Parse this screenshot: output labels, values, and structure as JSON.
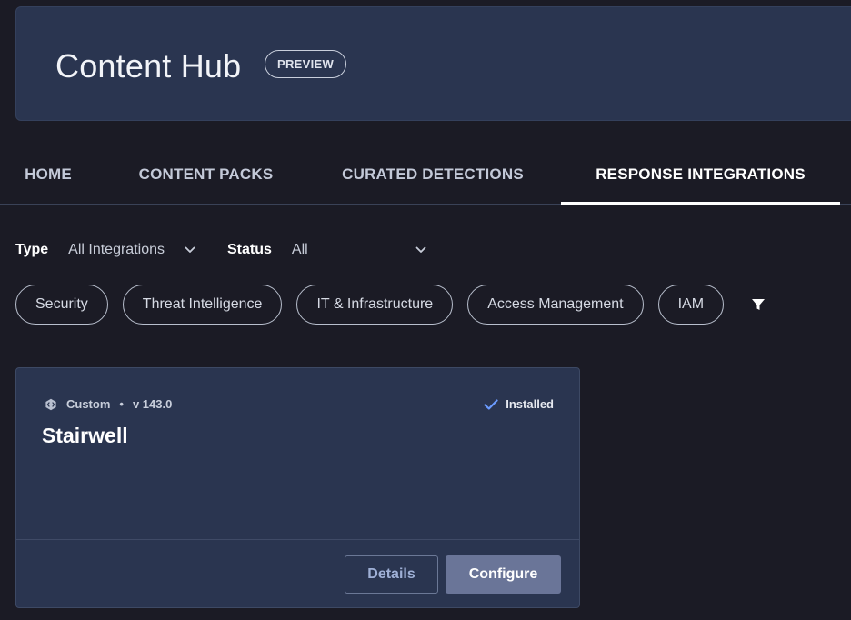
{
  "header": {
    "title": "Content Hub",
    "badge": "PREVIEW"
  },
  "tabs": [
    {
      "label": "HOME",
      "active": false
    },
    {
      "label": "CONTENT PACKS",
      "active": false
    },
    {
      "label": "CURATED DETECTIONS",
      "active": false
    },
    {
      "label": "RESPONSE INTEGRATIONS",
      "active": true
    }
  ],
  "filters": {
    "type_label": "Type",
    "type_value": "All Integrations",
    "status_label": "Status",
    "status_value": "All"
  },
  "chips": [
    "Security",
    "Threat Intelligence",
    "IT & Infrastructure",
    "Access Management",
    "IAM"
  ],
  "card": {
    "source": "Custom",
    "version": "v 143.0",
    "status": "Installed",
    "title": "Stairwell",
    "details_label": "Details",
    "configure_label": "Configure"
  },
  "icons": {
    "chevron": "chevron-down-icon",
    "filter": "filter-icon",
    "custom": "custom-integration-icon",
    "check": "check-icon"
  },
  "colors": {
    "background": "#1b1b25",
    "panel": "#2a3550",
    "check": "#6b9bff",
    "configure_button": "#6a7598"
  }
}
